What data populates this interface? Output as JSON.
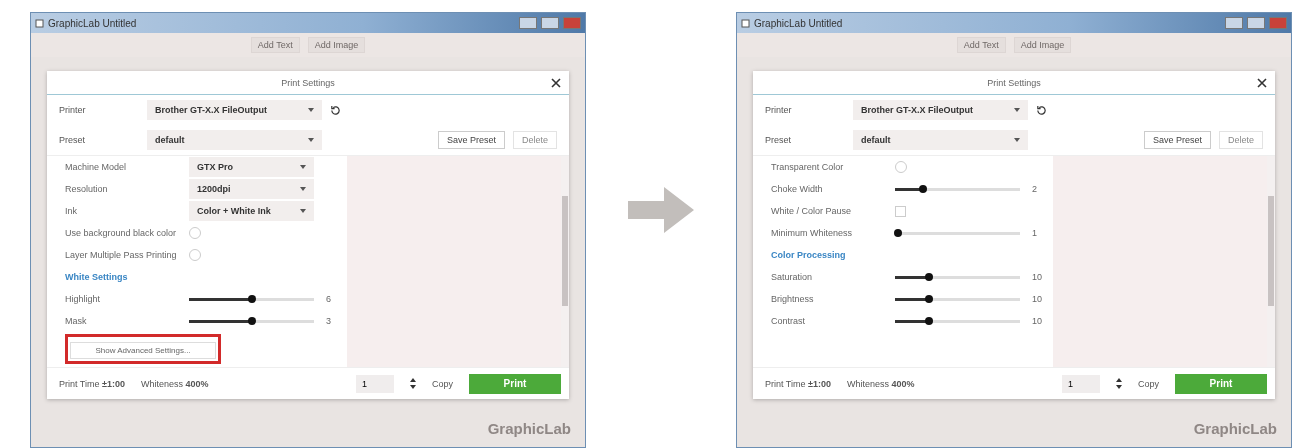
{
  "screens": [
    {
      "window_title": "GraphicLab Untitled",
      "toolbar": [
        "Add Text",
        "Add Image"
      ],
      "dialog": {
        "title": "Print Settings",
        "fields": [
          {
            "label": "Printer",
            "value": "Brother GT-X.X FileOutput",
            "refresh": true
          },
          {
            "label": "Preset",
            "value": "default",
            "refresh": false
          }
        ],
        "buttons": [
          {
            "label": "Save Preset",
            "disabled": false
          },
          {
            "label": "Delete",
            "disabled": true
          }
        ],
        "settings": [
          {
            "kind": "select",
            "label": "Machine Model",
            "value": "GTX Pro"
          },
          {
            "kind": "select",
            "label": "Resolution",
            "value": "1200dpi"
          },
          {
            "kind": "select",
            "label": "Ink",
            "value": "Color + White Ink"
          },
          {
            "kind": "toggle",
            "label": "Use background black color",
            "checked": false
          },
          {
            "kind": "toggle",
            "label": "Layer Multiple Pass Printing",
            "checked": false
          },
          {
            "kind": "heading",
            "label": "White Settings"
          },
          {
            "kind": "slider",
            "label": "Highlight",
            "level": 0.5,
            "reading": "6"
          },
          {
            "kind": "slider",
            "label": "Mask",
            "level": 0.5,
            "reading": "3"
          },
          {
            "kind": "button",
            "label": "Show Advanced Settings...",
            "highlighted": true
          }
        ],
        "footer": {
          "print_time": "Print Time **±1:00**",
          "whiteness": "Whiteness **400%**",
          "copies": "1",
          "copy_label": "Copy",
          "print_button": "Print"
        }
      },
      "logo": "GraphicLab"
    },
    {
      "window_title": "GraphicLab Untitled",
      "toolbar": [
        "Add Text",
        "Add Image"
      ],
      "dialog": {
        "title": "Print Settings",
        "fields": [
          {
            "label": "Printer",
            "value": "Brother GT-X.X FileOutput",
            "refresh": true
          },
          {
            "label": "Preset",
            "value": "default",
            "refresh": false
          }
        ],
        "buttons": [
          {
            "label": "Save Preset",
            "disabled": false
          },
          {
            "label": "Delete",
            "disabled": true
          }
        ],
        "settings": [
          {
            "kind": "toggle",
            "label": "Transparent Color",
            "checked": false
          },
          {
            "kind": "slider",
            "label": "Choke Width",
            "level": 0.22,
            "reading": "2"
          },
          {
            "kind": "checkbox",
            "label": "White / Color Pause",
            "checked": false
          },
          {
            "kind": "slider",
            "label": "Minimum Whiteness",
            "level": 0.02,
            "reading": "1"
          },
          {
            "kind": "heading",
            "label": "Color Processing"
          },
          {
            "kind": "slider",
            "label": "Saturation",
            "level": 0.27,
            "reading": "10"
          },
          {
            "kind": "slider",
            "label": "Brightness",
            "level": 0.27,
            "reading": "10"
          },
          {
            "kind": "slider",
            "label": "Contrast",
            "level": 0.27,
            "reading": "10"
          }
        ],
        "footer": {
          "print_time": "Print Time **±1:00**",
          "whiteness": "Whiteness **400%**",
          "copies": "1",
          "copy_label": "Copy",
          "print_button": "Print"
        }
      },
      "logo": "GraphicLab"
    }
  ]
}
